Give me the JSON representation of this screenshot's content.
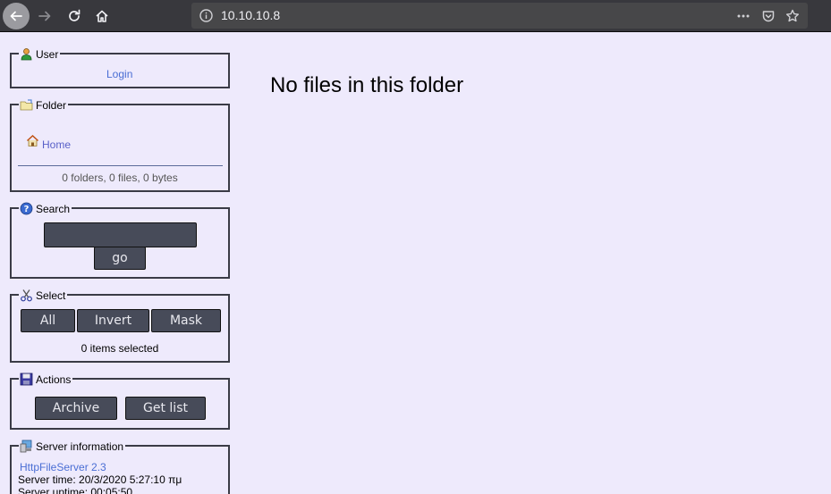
{
  "browser": {
    "url": "10.10.10.8"
  },
  "sidebar": {
    "user": {
      "title": "User",
      "login_label": "Login"
    },
    "folder": {
      "title": "Folder",
      "home_label": "Home",
      "summary": "0 folders, 0 files, 0 bytes"
    },
    "search": {
      "title": "Search",
      "input_value": "",
      "go_label": "go"
    },
    "select": {
      "title": "Select",
      "all_label": "All",
      "invert_label": "Invert",
      "mask_label": "Mask",
      "status": "0 items selected"
    },
    "actions": {
      "title": "Actions",
      "archive_label": "Archive",
      "getlist_label": "Get list"
    },
    "server": {
      "title": "Server information",
      "version_link": "HttpFileServer 2.3",
      "server_time": "Server time: 20/3/2020 5:27:10 πμ",
      "server_uptime": "Server uptime: 00:05:50"
    }
  },
  "main": {
    "message": "No files in this folder"
  },
  "colors": {
    "page_bg": "#eeeafc",
    "toolbar_bg": "#38383d",
    "link": "#4a6ed4",
    "button_bg": "#474b59"
  }
}
